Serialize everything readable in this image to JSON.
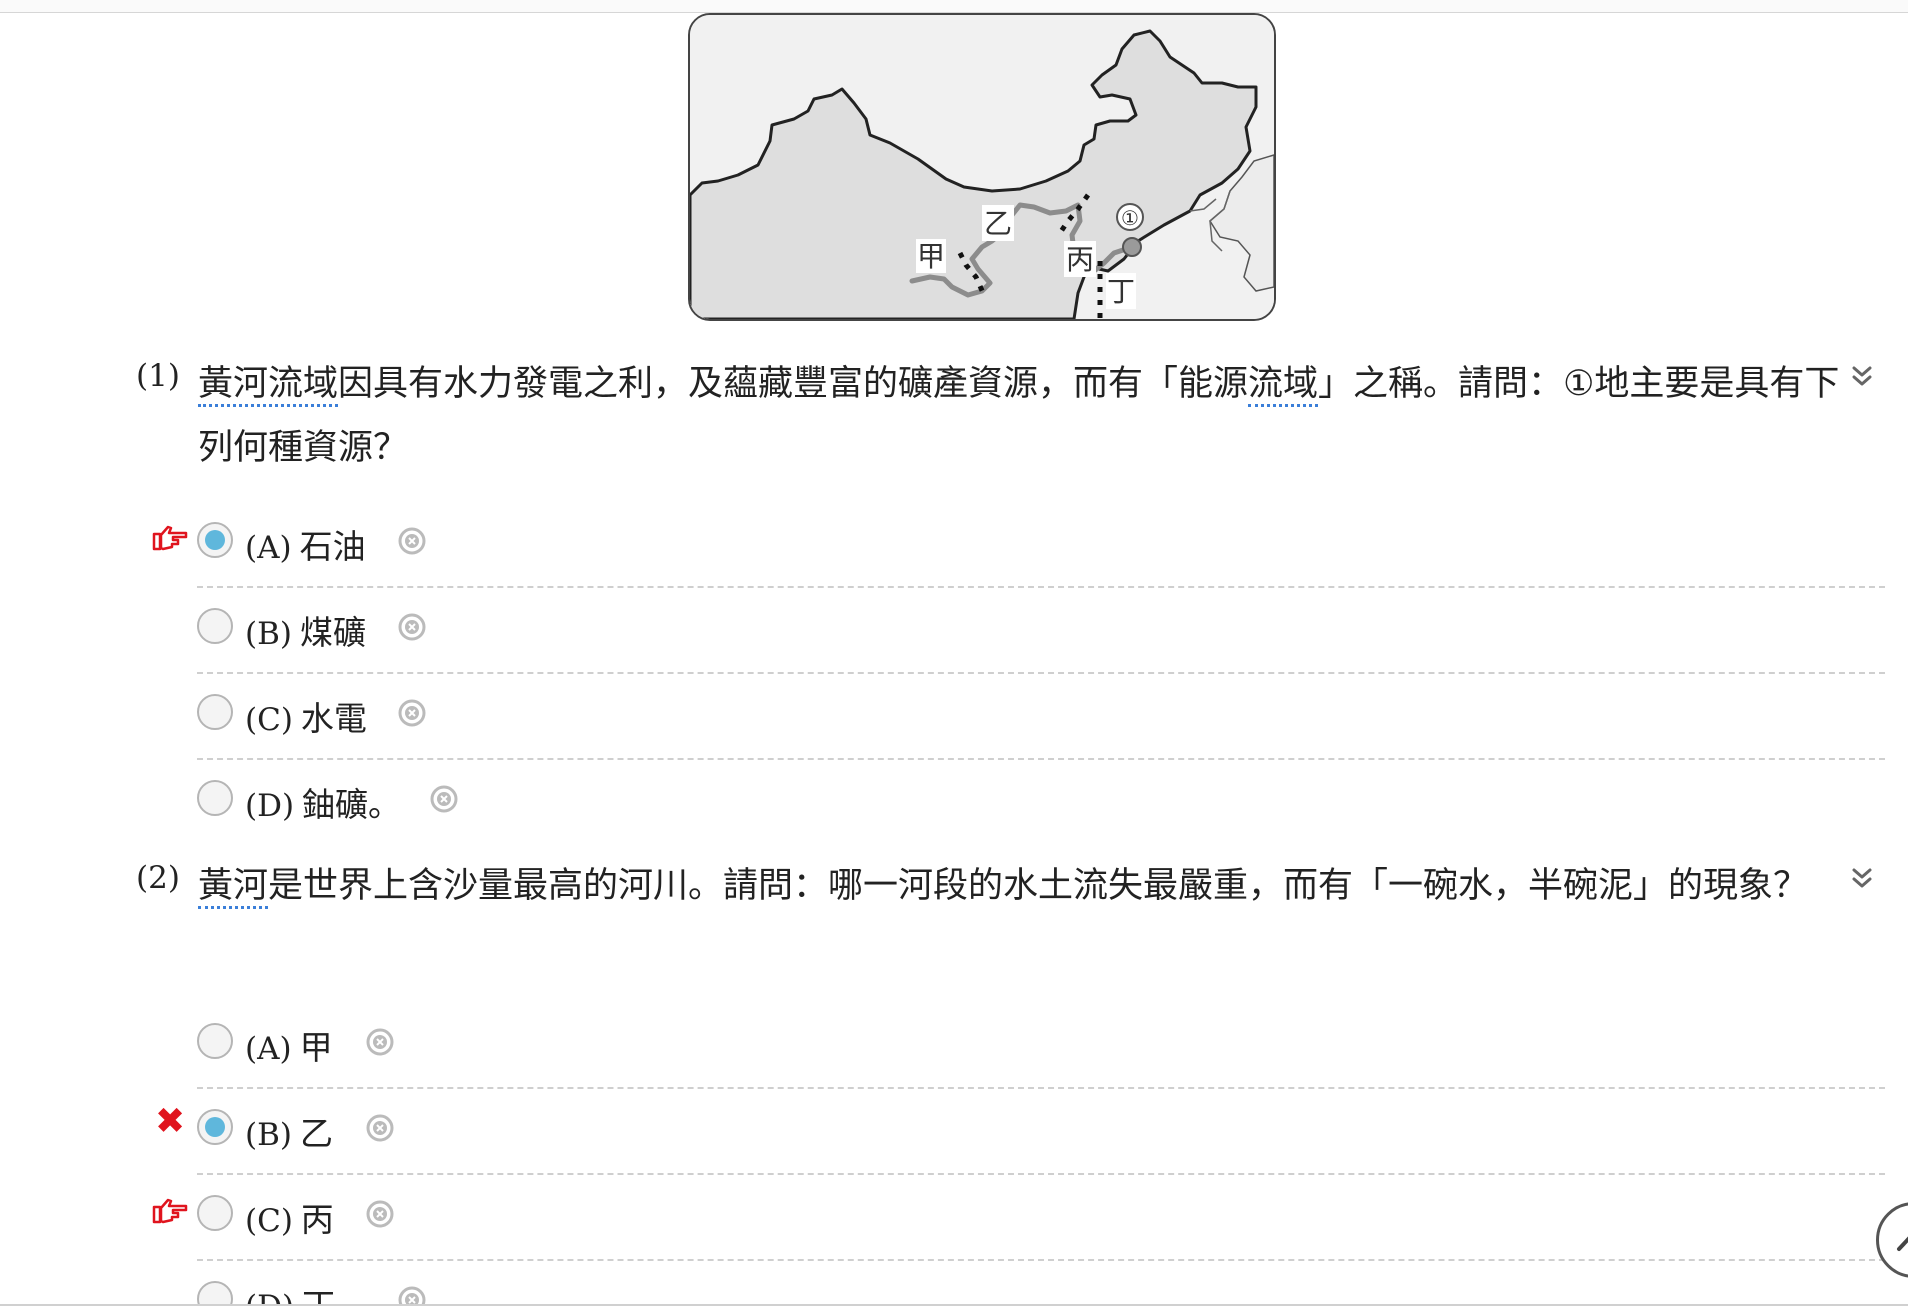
{
  "map": {
    "labels": {
      "jia": "甲",
      "yi": "乙",
      "bing": "丙",
      "ding": "丁",
      "point": "①"
    }
  },
  "questions": [
    {
      "number": "(1)",
      "text_part1": "黃河流域",
      "text_part2": "因具有水力發電之利，及蘊藏豐富的礦產資源，而有「能源",
      "text_part3": "流域",
      "text_part4": "」之稱。請問：①地主要是具有下列何種資源？",
      "options": [
        {
          "letter": "(A)",
          "text": "石油",
          "selected": true,
          "correct": true
        },
        {
          "letter": "(B)",
          "text": "煤礦",
          "selected": false
        },
        {
          "letter": "(C)",
          "text": "水電",
          "selected": false
        },
        {
          "letter": "(D)",
          "text": "鈾礦。",
          "selected": false
        }
      ]
    },
    {
      "number": "(2)",
      "text_part1": "黃河",
      "text_part2": "是世界上含沙量最高的河川。請問：哪一河段的水土流失最嚴重，而有「一碗水，半碗泥」的現象？",
      "options": [
        {
          "letter": "(A)",
          "text": "甲",
          "selected": false
        },
        {
          "letter": "(B)",
          "text": "乙",
          "selected": true,
          "wrong": true
        },
        {
          "letter": "(C)",
          "text": "丙",
          "selected": false,
          "correct": true
        },
        {
          "letter": "(D)",
          "text": "丁。",
          "selected": false
        }
      ]
    }
  ],
  "icons": {
    "expand": "chevron-double-down-icon",
    "clear": "clear-circle-icon",
    "correct_marker": "pointing-hand-icon",
    "wrong_marker": "cross-mark-icon",
    "scroll_top": "scroll-to-top-icon"
  },
  "colors": {
    "selected_radio": "#5fb7dc",
    "marker_red": "#e0141e",
    "link_underline": "#3b7fd9"
  }
}
